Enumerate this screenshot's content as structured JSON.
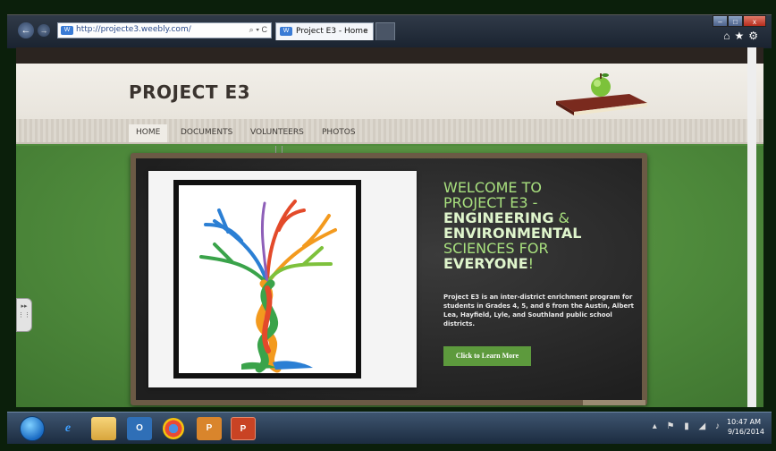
{
  "browser": {
    "url": "http://projecte3.weebly.com/",
    "address_controls": "⌕ ▾ C",
    "tab_title": "Project E3 - Home",
    "tab_close": "×",
    "back": "←",
    "forward": "→",
    "window_buttons": {
      "min": "–",
      "max": "□",
      "close": "x"
    },
    "tool_icons": "⌂★⚙"
  },
  "site": {
    "title": "PROJECT E3",
    "nav": [
      "HOME",
      "DOCUMENTS",
      "VOLUNTEERS",
      "PHOTOS"
    ],
    "welcome": {
      "line1": "WELCOME TO",
      "line2": "PROJECT E3 -",
      "eng": "ENGINEERING",
      "amp": " &",
      "env": "ENVIRONMENTAL",
      "line5": "SCIENCES FOR",
      "every": "EVERYONE",
      "bang": "!"
    },
    "description": "Project E3 is an inter-district enrichment program for students in Grades 4, 5, and 6 from the Austin, Albert Lea, Hayfield, Lyle, and Southland public school districts.",
    "button": "Click to Learn More"
  },
  "taskbar": {
    "time": "10:47 AM",
    "date": "9/16/2014",
    "apps": [
      "start",
      "internet-explorer",
      "file-explorer",
      "outlook",
      "chrome",
      "powerpoint",
      "powerpoint"
    ]
  },
  "colors": {
    "accent_green": "#5d9a3d",
    "headline_green": "#a8e07e",
    "chalkboard": "#2a2a2a"
  }
}
